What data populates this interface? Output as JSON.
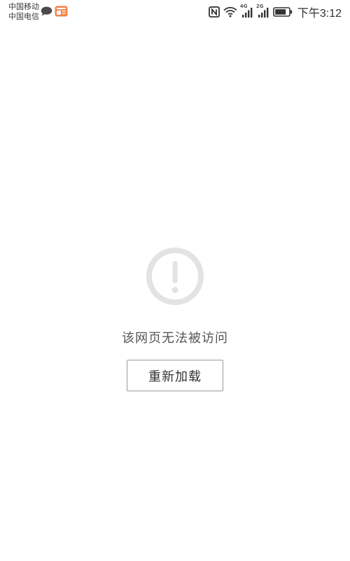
{
  "status_bar": {
    "carrier_primary": "中国移动",
    "carrier_secondary": "中国电信",
    "notification_icons": [
      "chat-bubble-icon",
      "news-app-icon"
    ],
    "indicator_icons": [
      "nfc-icon",
      "wifi-icon",
      "signal-4g-icon",
      "signal-2g-icon",
      "battery-icon"
    ],
    "network_1": "4G",
    "network_2": "2G",
    "time": "下午3:12"
  },
  "error_page": {
    "icon": "exclamation-circle-icon",
    "message": "该网页无法被访问",
    "reload_label": "重新加载"
  },
  "colors": {
    "background": "#ffffff",
    "icon_gray": "#e3e3e3",
    "text": "#555555",
    "button_border": "#9a9a9a"
  }
}
